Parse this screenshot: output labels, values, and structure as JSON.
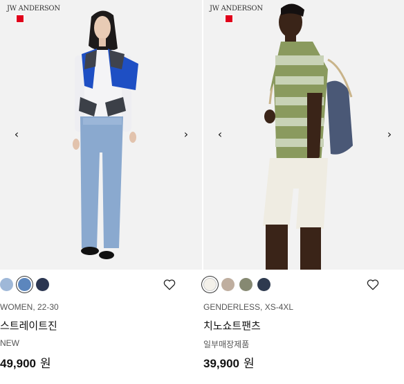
{
  "products": [
    {
      "brand_logo": "JW ANDERSON",
      "prev_arrow": "‹",
      "next_arrow": "›",
      "colors": [
        "#9fb8d8",
        "#5c86bd",
        "#2b3651"
      ],
      "selected_color_index": 1,
      "category": "WOMEN,  22-30",
      "name": "스트레이트진",
      "tag": "NEW",
      "price": "49,900",
      "currency": "원"
    },
    {
      "brand_logo": "JW ANDERSON",
      "prev_arrow": "‹",
      "next_arrow": "›",
      "colors": [
        "#f4f1ea",
        "#bfae9f",
        "#868972",
        "#2e3a4f"
      ],
      "selected_color_index": 0,
      "category": "GENDERLESS,  XS-4XL",
      "name": "치노쇼트팬츠",
      "tag": "일부매장제품",
      "price": "39,900",
      "currency": "원"
    }
  ]
}
